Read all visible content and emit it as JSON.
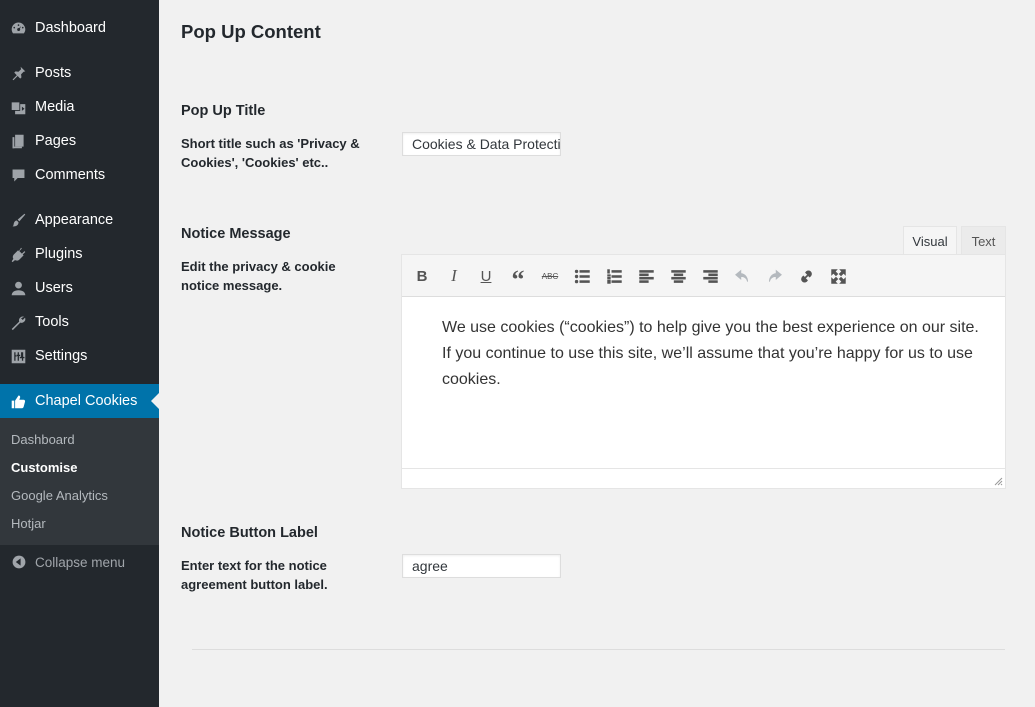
{
  "sidebar": {
    "menu": [
      {
        "label": "Dashboard",
        "icon": "dashboard-icon"
      },
      {
        "label": "Posts",
        "icon": "pin-icon"
      },
      {
        "label": "Media",
        "icon": "media-icon"
      },
      {
        "label": "Pages",
        "icon": "pages-icon"
      },
      {
        "label": "Comments",
        "icon": "comment-icon"
      },
      {
        "label": "Appearance",
        "icon": "brush-icon"
      },
      {
        "label": "Plugins",
        "icon": "plug-icon"
      },
      {
        "label": "Users",
        "icon": "user-icon"
      },
      {
        "label": "Tools",
        "icon": "wrench-icon"
      },
      {
        "label": "Settings",
        "icon": "sliders-icon"
      },
      {
        "label": "Chapel Cookies",
        "icon": "thumbs-up-icon",
        "active": true
      }
    ],
    "submenu": [
      {
        "label": "Dashboard"
      },
      {
        "label": "Customise",
        "current": true
      },
      {
        "label": "Google Analytics"
      },
      {
        "label": "Hotjar"
      }
    ],
    "collapse_label": "Collapse menu"
  },
  "main": {
    "page_title": "Pop Up Content",
    "popup_title": {
      "heading": "Pop Up Title",
      "description": "Short title such as 'Privacy & Cookies', 'Cookies' etc..",
      "value": "Cookies & Data Protection"
    },
    "notice_message": {
      "heading": "Notice Message",
      "description": "Edit the privacy & cookie notice message.",
      "tabs": {
        "visual": "Visual",
        "text": "Text"
      },
      "toolbar": [
        "bold-icon",
        "italic-icon",
        "underline-icon",
        "blockquote-icon",
        "strikethrough-icon",
        "bullet-list-icon",
        "numbered-list-icon",
        "align-left-icon",
        "align-center-icon",
        "align-right-icon",
        "undo-icon",
        "redo-icon",
        "link-icon",
        "fullscreen-icon"
      ],
      "content": {
        "line1": "We use cookies (“cookies”) to help give you the best experience on our site.",
        "line2": "If you continue to use this site, we’ll assume that you’re happy for us to use cookies."
      }
    },
    "button_label": {
      "heading": "Notice Button Label",
      "description": "Enter text for the notice agreement button label.",
      "value": "agree"
    }
  },
  "colors": {
    "sidebar_bg": "#23282d",
    "submenu_bg": "#32373c",
    "accent": "#0073aa",
    "page_bg": "#f1f1f1"
  }
}
